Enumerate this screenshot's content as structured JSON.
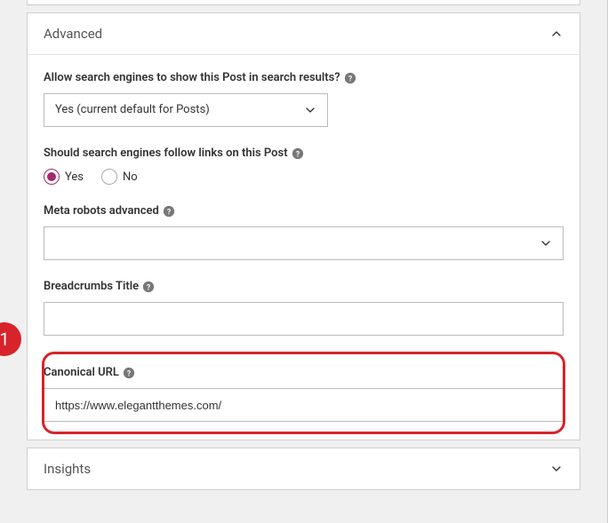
{
  "panels": {
    "advanced": {
      "title": "Advanced"
    },
    "insights": {
      "title": "Insights"
    }
  },
  "fields": {
    "allowSearch": {
      "label": "Allow search engines to show this Post in search results?",
      "value": "Yes (current default for Posts)"
    },
    "followLinks": {
      "label": "Should search engines follow links on this Post",
      "options": {
        "yes": "Yes",
        "no": "No"
      },
      "selected": "yes"
    },
    "metaRobots": {
      "label": "Meta robots advanced",
      "value": ""
    },
    "breadcrumbs": {
      "label": "Breadcrumbs Title",
      "value": ""
    },
    "canonical": {
      "label": "Canonical URL",
      "value": "https://www.elegantthemes.com/"
    }
  },
  "callout": {
    "number": "1"
  }
}
